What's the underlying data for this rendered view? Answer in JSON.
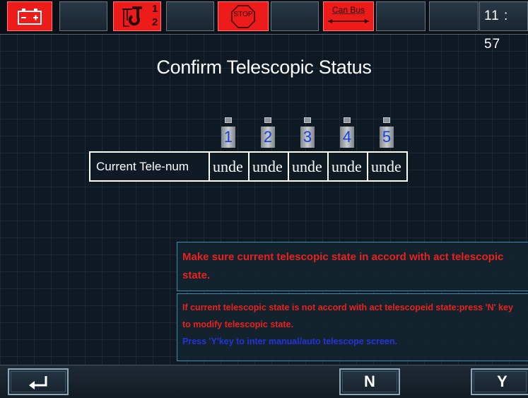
{
  "status_bar": {
    "cells": [
      {
        "name": "battery-icon",
        "style": "red"
      },
      {
        "name": "blank",
        "style": "dark"
      },
      {
        "name": "hook-icon",
        "style": "red",
        "digits": [
          "1",
          "2"
        ]
      },
      {
        "name": "blank",
        "style": "dark"
      },
      {
        "name": "stop-icon",
        "style": "red",
        "label": "STOP"
      },
      {
        "name": "blank",
        "style": "dark"
      },
      {
        "name": "can-bus-icon",
        "style": "red",
        "label": "Can Bus"
      },
      {
        "name": "blank",
        "style": "dark"
      },
      {
        "name": "blank",
        "style": "dark"
      }
    ],
    "clock": "11 : 57"
  },
  "title": "Confirm Telescopic Status",
  "pins": [
    "1",
    "2",
    "3",
    "4",
    "5"
  ],
  "table": {
    "label": "Current Tele-num",
    "values": [
      "unde",
      "unde",
      "unde",
      "unde",
      "unde"
    ]
  },
  "messages": {
    "confirm": "Make sure current telescopic state in accord with act telescopic state.",
    "modify": "If current telescopic state is not accord with act telescopeid state:press 'N' key to modify telescopic state.",
    "enter": "Press 'Y'key to inter manual/auto telescope screen."
  },
  "buttons": {
    "back": "back-enter-icon",
    "n": "N",
    "y": "Y"
  },
  "colors": {
    "accent_red": "#ee1b1b",
    "warning_text": "#e8221e",
    "info_blue": "#2433d8",
    "pin_number": "#1a3fe0"
  }
}
